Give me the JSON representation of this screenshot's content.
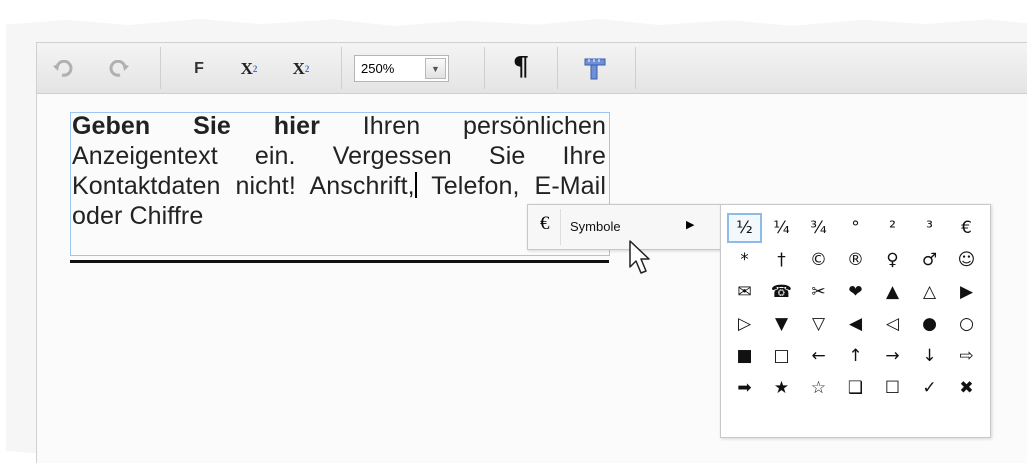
{
  "toolbar": {
    "bold_label": "F",
    "superscript_base": "X",
    "superscript_mark": "2",
    "subscript_base": "X",
    "subscript_mark": "2",
    "zoom_value": "250%",
    "paragraph_label": "¶"
  },
  "ad_text": {
    "bold_part": "Geben Sie hier",
    "before_cursor": " Ihren persönlichen Anzeigentext ein. Vergessen Sie Ihre Kontaktdaten nicht! Anschrift,",
    "after_cursor": " Tele­fon, E-Mail oder Chiffre"
  },
  "context_menu": {
    "icon": "€",
    "label": "Symbole"
  },
  "symbols": [
    "½",
    "¼",
    "¾",
    "°",
    "²",
    "³",
    "€",
    "*",
    "†",
    "©",
    "®",
    "♀",
    "♂",
    "☺",
    "✉",
    "☎",
    "✂",
    "❤",
    "▲",
    "△",
    "▶",
    "▷",
    "▼",
    "▽",
    "◀",
    "◁",
    "●",
    "○",
    "■",
    "□",
    "←",
    "↑",
    "→",
    "↓",
    "⇨",
    "➡",
    "★",
    "☆",
    "❑",
    "☐",
    "✓",
    "✖"
  ],
  "selected_symbol_index": 0,
  "icons": {
    "undo": "undo-icon",
    "redo": "redo-icon",
    "ruler": "ruler-icon",
    "zoom_dropdown": "chevron-down-icon",
    "submenu": "caret-right-icon",
    "pointer": "mouse-pointer-icon"
  },
  "colors": {
    "selection_border": "#8dbce8",
    "textbox_border": "#9cc7ef",
    "subscript_accent": "#3a6fd8"
  }
}
